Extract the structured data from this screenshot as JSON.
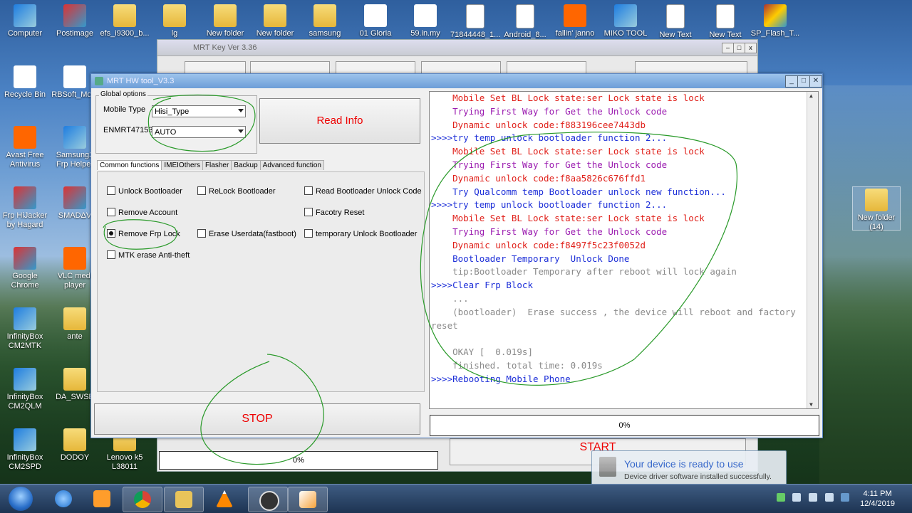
{
  "desktop": {
    "icons_top": [
      "Computer",
      "Postimage",
      "efs_i9300_b...",
      "lg",
      "New folder",
      "New folder",
      "samsung",
      "01 Gloria",
      "59.in.my",
      "71844448_1...",
      "Android_8...",
      "fallin' janno",
      "MIKO TOOL",
      "New Text",
      "New Text",
      "SP_Flash_T..."
    ],
    "icons_left": [
      [
        "Recycle Bin"
      ],
      [
        "RBSoft_Mo..."
      ],
      [
        "Avast Free",
        "Antivirus"
      ],
      [
        "Samsung2",
        "Frp Helper"
      ],
      [
        "Frp HiJacker",
        "by Hagard"
      ],
      [
        "SMADΔV"
      ],
      [
        "Google",
        "Chrome"
      ],
      [
        "VLC medi",
        "player"
      ],
      [
        "InfinityBox",
        "CM2MTK"
      ],
      [
        "ante"
      ],
      [
        "InfinityBox",
        "CM2QLM"
      ],
      [
        "DA_SWSE"
      ],
      [
        "InfinityBox",
        "CM2SPD"
      ],
      [
        "DODOY"
      ],
      [
        "Lenovo k5",
        "L38011"
      ]
    ],
    "right_folder": [
      "New folder",
      "(14)"
    ]
  },
  "back_window": {
    "title": "MRT Key Ver 3.36",
    "start_label": "START",
    "progress": "0%"
  },
  "window": {
    "title": "MRT HW tool_V3.3",
    "global_options": "Global options",
    "mobile_type_label": "Mobile Type",
    "mobile_type_value": "Hisi_Type",
    "enmrt_label": "ENMRT47153",
    "enmrt_value": "AUTO",
    "read_info": "Read Info",
    "tabs": [
      "Common functions",
      "IMEIOthers",
      "Flasher",
      "Backup",
      "Advanced function"
    ],
    "checkboxes": {
      "unlock_bootloader": "Unlock Bootloader",
      "relock_bootloader": "ReLock Bootloader",
      "read_bl_unlock_code": "Read Bootloader Unlock Code",
      "remove_account": "Remove Account",
      "factory_reset": "Facotry Reset",
      "remove_frp_lock": "Remove Frp Lock",
      "erase_userdata": "Erase Userdata(fastboot)",
      "temp_unlock_bl": "temporary Unlock Bootloader",
      "mtk_erase": "MTK erase Anti-theft"
    },
    "stop_label": "STOP",
    "progress": "0%"
  },
  "log": [
    {
      "t": "    Mobile Set BL Lock state:ser Lock state is lock",
      "c": "c-red"
    },
    {
      "t": "    Trying First Way for Get the Unlock code",
      "c": "c-pur"
    },
    {
      "t": "    Dynamic unlock code:f883196cee7443db",
      "c": "c-red"
    },
    {
      "t": ">>>>try temp unlock bootloader function 2...",
      "c": "c-blue"
    },
    {
      "t": "    Mobile Set BL Lock state:ser Lock state is lock",
      "c": "c-red"
    },
    {
      "t": "    Trying First Way for Get the Unlock code",
      "c": "c-pur"
    },
    {
      "t": "    Dynamic unlock code:f8aa5826c676ffd1",
      "c": "c-red"
    },
    {
      "t": "    Try Qualcomm temp Bootloader unlock new function...",
      "c": "c-blue"
    },
    {
      "t": ">>>>try temp unlock bootloader function 2...",
      "c": "c-blue"
    },
    {
      "t": "    Mobile Set BL Lock state:ser Lock state is lock",
      "c": "c-red"
    },
    {
      "t": "    Trying First Way for Get the Unlock code",
      "c": "c-pur"
    },
    {
      "t": "    Dynamic unlock code:f8497f5c23f0052d",
      "c": "c-red"
    },
    {
      "t": "    Bootloader Temporary  Unlock Done",
      "c": "c-blue"
    },
    {
      "t": "    tip:Bootloader Temporary after reboot will lock again",
      "c": "c-gray"
    },
    {
      "t": ">>>>Clear Frp Block",
      "c": "c-blue"
    },
    {
      "t": "    ...",
      "c": "c-gray"
    },
    {
      "t": "    (bootloader)  Erase success , the device will reboot and factory",
      "c": "c-gray"
    },
    {
      "t": "reset",
      "c": "c-gray"
    },
    {
      "t": "",
      "c": "c-gray"
    },
    {
      "t": "    OKAY [  0.019s]",
      "c": "c-gray"
    },
    {
      "t": "    finished. total time: 0.019s",
      "c": "c-gray"
    },
    {
      "t": ">>>>Rebooting Mobile Phone",
      "c": "c-blue"
    }
  ],
  "notification": {
    "title": "Your device is ready to use",
    "subtitle": "Device driver software installed successfully."
  },
  "taskbar": {
    "time": "4:11 PM",
    "date": "12/4/2019"
  }
}
